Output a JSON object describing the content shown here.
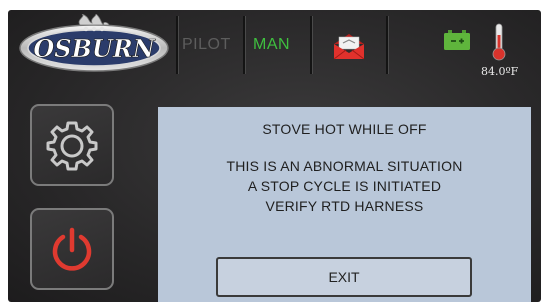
{
  "header": {
    "brand": "OSBURN",
    "mode_pilot": "PILOT",
    "mode_manual": "MAN",
    "temperature": "84.0ºF"
  },
  "icons": {
    "logo": "osburn-flame-logo",
    "mail": "mail-icon",
    "battery": "battery-icon",
    "thermometer": "thermometer-icon",
    "settings": "gear-icon",
    "power": "power-icon"
  },
  "dialog": {
    "title": "STOVE HOT WHILE OFF",
    "lines": [
      "THIS IS AN ABNORMAL SITUATION",
      "A STOP CYCLE IS INITIATED",
      "VERIFY RTD HARNESS"
    ],
    "exit_label": "EXIT"
  },
  "colors": {
    "manual_active": "#3fbf3f",
    "pilot_inactive": "#5d5d5d",
    "mail_red": "#e0312c",
    "power_red": "#e03a30",
    "battery_green": "#5fb53c",
    "dialog_bg": "#b9c7d9"
  }
}
